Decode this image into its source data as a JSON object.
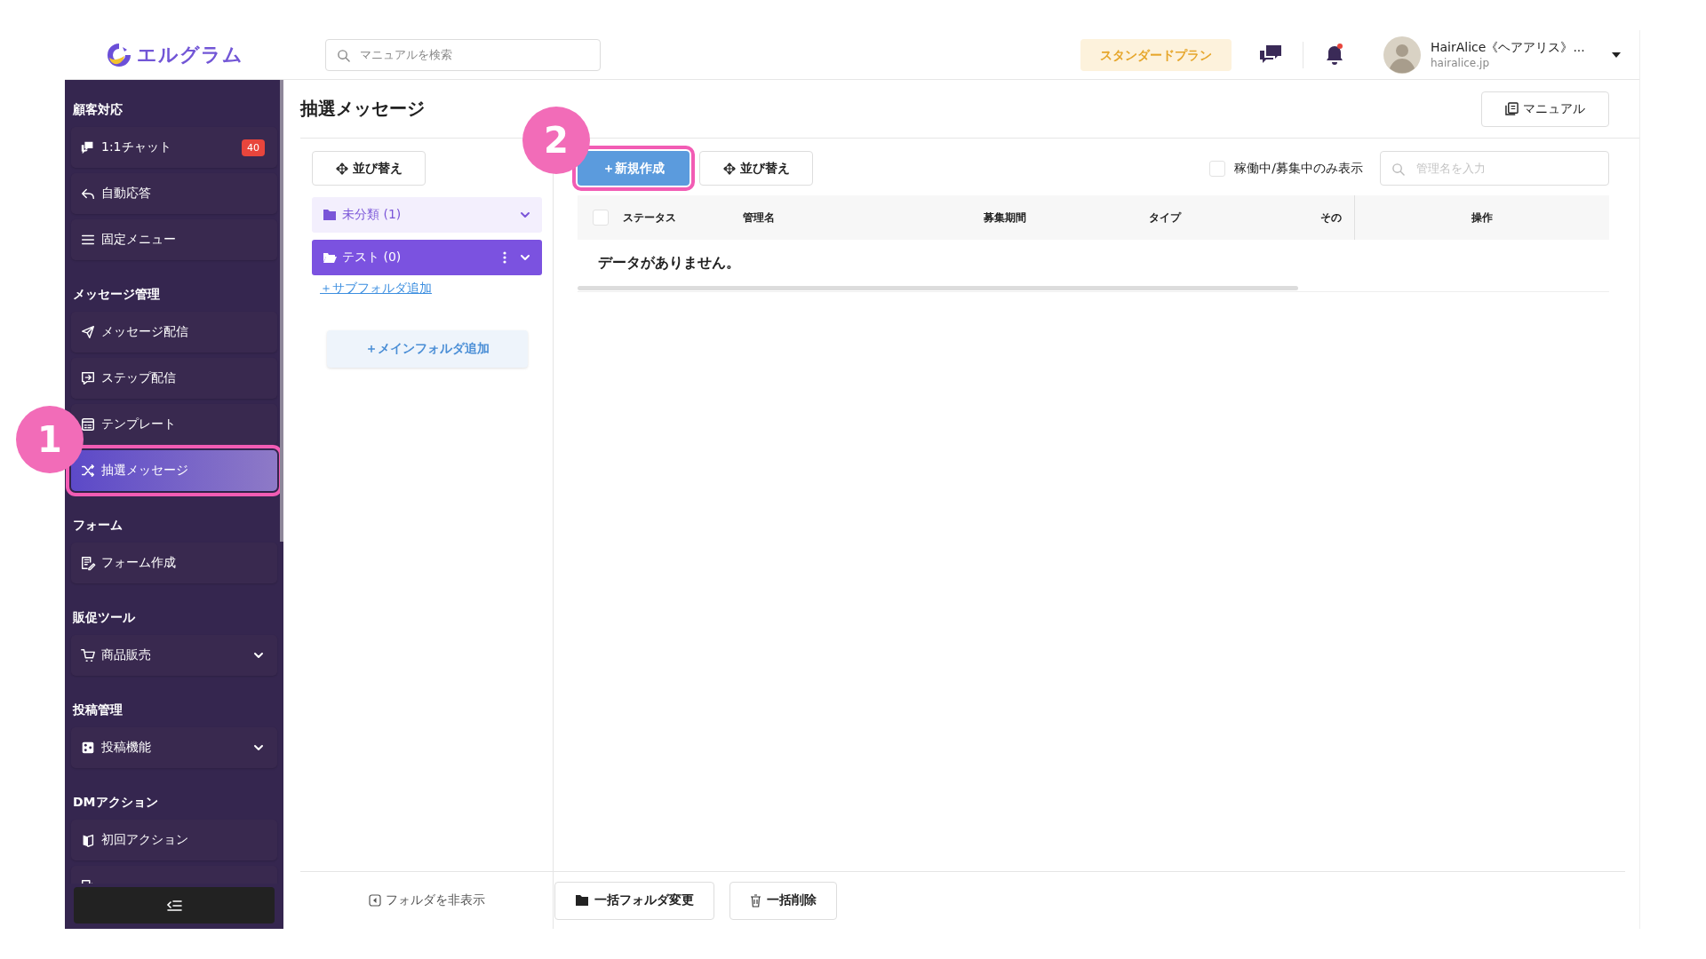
{
  "header": {
    "logo": "エルグラム",
    "search": {
      "placeholder": "マニュアルを検索"
    },
    "plan": "スタンダードプラン",
    "notification_unread": true,
    "account": {
      "name": "HairAlice《ヘアアリス》...",
      "domain": "hairalice.jp"
    }
  },
  "sidebar": {
    "sections": [
      {
        "title": "顧客対応",
        "items": [
          {
            "label": "1:1チャット",
            "kind": "chat",
            "badge": "40",
            "selected": false,
            "expandable": false,
            "highlighted": false
          },
          {
            "label": "自動応答",
            "kind": "reply",
            "selected": false,
            "expandable": false,
            "highlighted": false
          },
          {
            "label": "固定メニュー",
            "kind": "menu",
            "selected": false,
            "expandable": false,
            "highlighted": false
          }
        ]
      },
      {
        "title": "メッセージ管理",
        "items": [
          {
            "label": "メッセージ配信",
            "kind": "send",
            "selected": false,
            "expandable": false,
            "highlighted": false
          },
          {
            "label": "ステップ配信",
            "kind": "step",
            "selected": false,
            "expandable": false,
            "highlighted": false
          },
          {
            "label": "テンプレート",
            "kind": "template",
            "selected": false,
            "expandable": false,
            "highlighted": false
          },
          {
            "label": "抽選メッセージ",
            "kind": "shuffle",
            "selected": true,
            "expandable": false,
            "highlighted": true,
            "callout": "1"
          }
        ]
      },
      {
        "title": "フォーム",
        "items": [
          {
            "label": "フォーム作成",
            "kind": "form",
            "selected": false,
            "expandable": false,
            "highlighted": false
          }
        ]
      },
      {
        "title": "販促ツール",
        "items": [
          {
            "label": "商品販売",
            "kind": "cart",
            "selected": false,
            "expandable": true,
            "highlighted": false
          }
        ]
      },
      {
        "title": "投稿管理",
        "items": [
          {
            "label": "投稿機能",
            "kind": "post",
            "selected": false,
            "expandable": true,
            "highlighted": false
          }
        ]
      },
      {
        "title": "DMアクション",
        "items": [
          {
            "label": "初回アクション",
            "kind": "book",
            "selected": false,
            "expandable": false,
            "highlighted": false
          },
          {
            "kind": "direct",
            "selected": false
          }
        ]
      }
    ]
  },
  "page": {
    "title": "抽選メッセージ",
    "manual_button": "マニュアル"
  },
  "folders": {
    "sort_button": "並び替え",
    "items": [
      {
        "label": "未分類 (1)",
        "selected": false,
        "has_menu": false
      },
      {
        "label": "テスト (0)",
        "selected": true,
        "has_menu": true
      }
    ],
    "add_subfolder": "＋サブフォルダ追加",
    "add_main_folder": "＋メインフォルダ追加",
    "hide_folders": "フォルダを非表示"
  },
  "list": {
    "new_button": {
      "label": "＋新規作成",
      "highlighted": true,
      "callout": "2"
    },
    "sort_button": "並び替え",
    "active_filter": {
      "label": "稼働中/募集中のみ表示",
      "checked": false
    },
    "search": {
      "placeholder": "管理名を入力"
    },
    "table": {
      "all_selected": false,
      "columns": [
        "ステータス",
        "管理名",
        "募集期間",
        "タイプ",
        "その",
        "操作"
      ],
      "empty_message": "データがありません。"
    },
    "bulk_buttons": [
      {
        "label": "一括フォルダ変更",
        "kind": "folder"
      },
      {
        "label": "一括削除",
        "kind": "delete"
      }
    ]
  }
}
